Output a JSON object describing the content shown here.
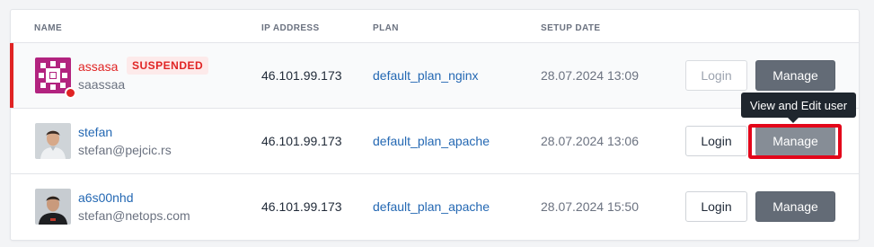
{
  "table": {
    "headers": {
      "name": "NAME",
      "ip": "IP ADDRESS",
      "plan": "PLAN",
      "setup_date": "SETUP DATE"
    },
    "rows": [
      {
        "username": "assasa",
        "status_badge": "SUSPENDED",
        "email": "saassaa",
        "ip": "46.101.99.173",
        "plan": "default_plan_nginx",
        "setup_date": "28.07.2024 13:09",
        "login_label": "Login",
        "manage_label": "Manage",
        "avatar": "identicon-magenta"
      },
      {
        "username": "stefan",
        "email": "stefan@pejcic.rs",
        "ip": "46.101.99.173",
        "plan": "default_plan_apache",
        "setup_date": "28.07.2024 13:06",
        "login_label": "Login",
        "manage_label": "Manage",
        "avatar": "user-photo"
      },
      {
        "username": "a6s00nhd",
        "email": "stefan@netops.com",
        "ip": "46.101.99.173",
        "plan": "default_plan_apache",
        "setup_date": "28.07.2024 15:50",
        "login_label": "Login",
        "manage_label": "Manage",
        "avatar": "user-photo"
      }
    ]
  },
  "tooltip": {
    "text": "View and Edit user"
  },
  "colors": {
    "link": "#2468b3",
    "danger": "#e02424",
    "manage_button": "#636b76",
    "highlight_box": "#e3061a"
  }
}
